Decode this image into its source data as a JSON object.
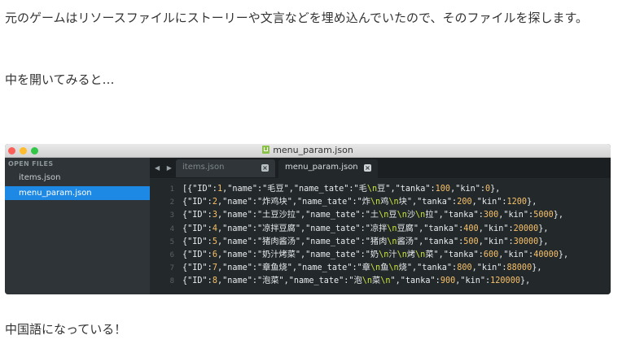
{
  "paragraphs": {
    "intro": "元のゲームはリソースファイルにストーリーや文言などを埋め込んでいたので、そのファイルを探します。",
    "open": "中を開いてみると…",
    "result": "中国語になっている！"
  },
  "editor": {
    "window_title": "menu_param.json",
    "sidebar": {
      "header": "OPEN FILES",
      "items": [
        "items.json",
        "menu_param.json"
      ],
      "selected_index": 1
    },
    "nav_arrows": "◀ ▶",
    "tabs": [
      {
        "label": "items.json",
        "close": "×",
        "active": false
      },
      {
        "label": "menu_param.json",
        "close": "×",
        "active": true
      }
    ],
    "line_numbers": [
      "1",
      "2",
      "3",
      "4",
      "5",
      "6",
      "7",
      "8"
    ],
    "lines": [
      [
        [
          "[{\"ID\":",
          "s"
        ],
        [
          "1",
          "n"
        ],
        [
          ",\"name\":\"毛豆\",\"name_tate\":\"毛",
          "s"
        ],
        [
          "\\n",
          "esc"
        ],
        [
          "豆\",\"tanka\":",
          "s"
        ],
        [
          "100",
          "n"
        ],
        [
          ",\"kin\":",
          "s"
        ],
        [
          "0",
          "n"
        ],
        [
          "},",
          "s"
        ]
      ],
      [
        [
          "{\"ID\":",
          "s"
        ],
        [
          "2",
          "n"
        ],
        [
          ",\"name\":\"炸鸡块\",\"name_tate\":\"炸",
          "s"
        ],
        [
          "\\n",
          "esc"
        ],
        [
          "鸡",
          "s"
        ],
        [
          "\\n",
          "esc"
        ],
        [
          "块\",\"tanka\":",
          "s"
        ],
        [
          "200",
          "n"
        ],
        [
          ",\"kin\":",
          "s"
        ],
        [
          "1200",
          "n"
        ],
        [
          "},",
          "s"
        ]
      ],
      [
        [
          "{\"ID\":",
          "s"
        ],
        [
          "3",
          "n"
        ],
        [
          ",\"name\":\"土豆沙拉\",\"name_tate\":\"土",
          "s"
        ],
        [
          "\\n",
          "esc"
        ],
        [
          "豆",
          "s"
        ],
        [
          "\\n",
          "esc"
        ],
        [
          "沙",
          "s"
        ],
        [
          "\\n",
          "esc"
        ],
        [
          "拉\",\"tanka\":",
          "s"
        ],
        [
          "300",
          "n"
        ],
        [
          ",\"kin\":",
          "s"
        ],
        [
          "5000",
          "n"
        ],
        [
          "},",
          "s"
        ]
      ],
      [
        [
          "{\"ID\":",
          "s"
        ],
        [
          "4",
          "n"
        ],
        [
          ",\"name\":\"凉拌豆腐\",\"name_tate\":\"凉拌",
          "s"
        ],
        [
          "\\n",
          "esc"
        ],
        [
          "豆腐\",\"tanka\":",
          "s"
        ],
        [
          "400",
          "n"
        ],
        [
          ",\"kin\":",
          "s"
        ],
        [
          "20000",
          "n"
        ],
        [
          "},",
          "s"
        ]
      ],
      [
        [
          "{\"ID\":",
          "s"
        ],
        [
          "5",
          "n"
        ],
        [
          ",\"name\":\"猪肉酱汤\",\"name_tate\":\"猪肉",
          "s"
        ],
        [
          "\\n",
          "esc"
        ],
        [
          "酱汤\",\"tanka\":",
          "s"
        ],
        [
          "500",
          "n"
        ],
        [
          ",\"kin\":",
          "s"
        ],
        [
          "30000",
          "n"
        ],
        [
          "},",
          "s"
        ]
      ],
      [
        [
          "{\"ID\":",
          "s"
        ],
        [
          "6",
          "n"
        ],
        [
          ",\"name\":\"奶汁烤菜\",\"name_tate\":\"奶",
          "s"
        ],
        [
          "\\n",
          "esc"
        ],
        [
          "汁",
          "s"
        ],
        [
          "\\n",
          "esc"
        ],
        [
          "烤",
          "s"
        ],
        [
          "\\n",
          "esc"
        ],
        [
          "菜\",\"tanka\":",
          "s"
        ],
        [
          "600",
          "n"
        ],
        [
          ",\"kin\":",
          "s"
        ],
        [
          "40000",
          "n"
        ],
        [
          "},",
          "s"
        ]
      ],
      [
        [
          "{\"ID\":",
          "s"
        ],
        [
          "7",
          "n"
        ],
        [
          ",\"name\":\"章鱼烧\",\"name_tate\":\"章",
          "s"
        ],
        [
          "\\n",
          "esc"
        ],
        [
          "鱼",
          "s"
        ],
        [
          "\\n",
          "esc"
        ],
        [
          "烧\",\"tanka\":",
          "s"
        ],
        [
          "800",
          "n"
        ],
        [
          ",\"kin\":",
          "s"
        ],
        [
          "88000",
          "n"
        ],
        [
          "},",
          "s"
        ]
      ],
      [
        [
          "{\"ID\":",
          "s"
        ],
        [
          "8",
          "n"
        ],
        [
          ",\"name\":\"泡菜\",\"name_tate\":\"泡",
          "s"
        ],
        [
          "\\n",
          "esc"
        ],
        [
          "菜",
          "s"
        ],
        [
          "\\n",
          "esc"
        ],
        [
          "\",\"tanka\":",
          "s"
        ],
        [
          "900",
          "n"
        ],
        [
          ",\"kin\":",
          "s"
        ],
        [
          "120000",
          "n"
        ],
        [
          "},",
          "s"
        ]
      ]
    ]
  }
}
